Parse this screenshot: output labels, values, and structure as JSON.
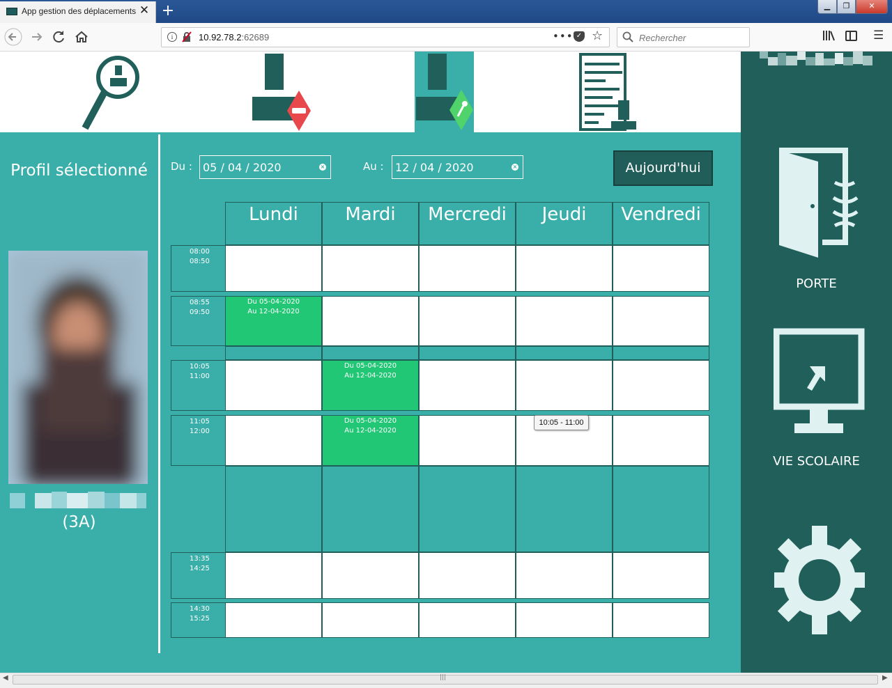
{
  "browser": {
    "tab_title": "App gestion des déplacements",
    "tab_close": "✕",
    "new_tab": "+",
    "url_host": "10.92.78.2",
    "url_port": ":62689",
    "search_placeholder": "Rechercher",
    "url_menu": "•••",
    "window_controls": {
      "minimize": "▁",
      "maximize": "❐",
      "close": "✕"
    }
  },
  "toolbar": {
    "icons": [
      "search-profile-icon",
      "remove-authorization-icon",
      "add-authorization-icon",
      "schedule-document-icon"
    ],
    "active_index": 2,
    "colors": {
      "dark": "#215f5a",
      "red": "#e8474c",
      "green": "#4fd36a"
    }
  },
  "profile": {
    "title": "Profil sélectionné",
    "class": "(3A)"
  },
  "filters": {
    "from_label": "Du :",
    "from_value": "05 / 04 / 2020",
    "to_label": "Au :",
    "to_value": "12 / 04 / 2020",
    "clear": "×",
    "today_button": "Aujourd'hui"
  },
  "schedule": {
    "days": [
      "Lundi",
      "Mardi",
      "Mercredi",
      "Jeudi",
      "Vendredi"
    ],
    "slots": [
      {
        "start": "08:00",
        "end": "08:50"
      },
      {
        "start": "08:55",
        "end": "09:50"
      },
      {
        "start": "10:05",
        "end": "11:00"
      },
      {
        "start": "11:05",
        "end": "12:00"
      },
      {
        "start": "13:35",
        "end": "14:25"
      },
      {
        "start": "14:30",
        "end": "15:25"
      }
    ],
    "authorizations": [
      {
        "slot": 1,
        "day": 0,
        "line1": "Du 05-04-2020",
        "line2": "Au 12-04-2020"
      },
      {
        "slot": 2,
        "day": 1,
        "line1": "Du 05-04-2020",
        "line2": "Au 12-04-2020"
      },
      {
        "slot": 3,
        "day": 1,
        "line1": "Du 05-04-2020",
        "line2": "Au 12-04-2020"
      }
    ],
    "tooltip": "10:05 - 11:00",
    "colors": {
      "authorized": "#21c774",
      "empty": "#ffffff",
      "background": "#3aafa9"
    }
  },
  "right_panel": {
    "door_label": "PORTE",
    "school_life_label": "VIE SCOLAIRE",
    "settings_icon": "gear-icon"
  }
}
